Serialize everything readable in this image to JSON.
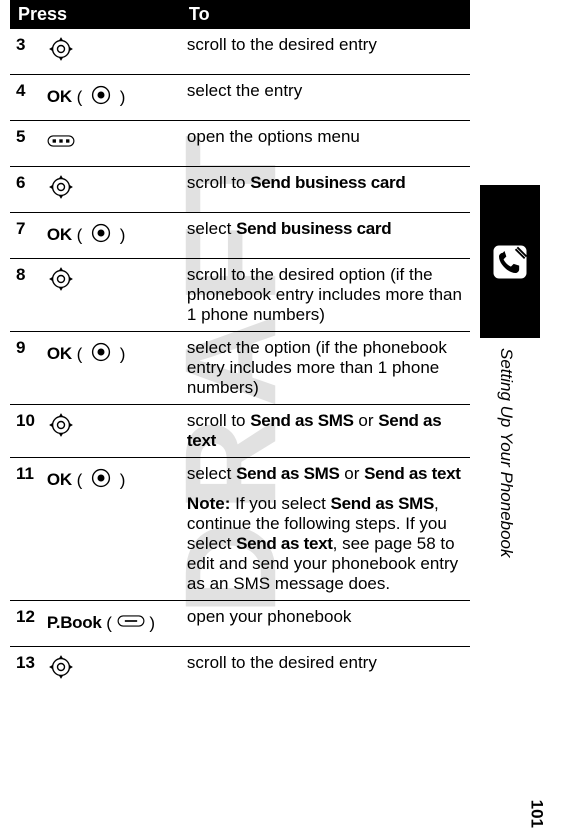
{
  "watermark": "DRAFT",
  "header": {
    "col_press": "Press",
    "col_to": "To"
  },
  "rows": [
    {
      "num": "3",
      "press_label": "",
      "press_icon": "nav",
      "to": "scroll to the desired entry"
    },
    {
      "num": "4",
      "press_label": "OK",
      "press_icon": "select",
      "to": "select the entry"
    },
    {
      "num": "5",
      "press_label": "",
      "press_icon": "menu",
      "to": "open the options menu"
    },
    {
      "num": "6",
      "press_label": "",
      "press_icon": "nav",
      "to_prefix": "scroll to ",
      "to_bold": "Send business card"
    },
    {
      "num": "7",
      "press_label": "OK",
      "press_icon": "select",
      "to_prefix": "select ",
      "to_bold": "Send business card"
    },
    {
      "num": "8",
      "press_label": "",
      "press_icon": "nav",
      "to": "scroll to the desired option (if the phonebook entry includes more than 1 phone numbers)"
    },
    {
      "num": "9",
      "press_label": "OK",
      "press_icon": "select",
      "to": "select the option (if the phonebook entry includes more than 1 phone numbers)"
    },
    {
      "num": "10",
      "press_label": "",
      "press_icon": "nav",
      "to_prefix": "scroll to ",
      "to_bold": "Send as SMS",
      "to_mid": " or ",
      "to_bold2": "Send as text"
    },
    {
      "num": "11",
      "press_label": "OK",
      "press_icon": "select",
      "to_prefix": "select ",
      "to_bold": "Send as SMS",
      "to_mid": " or ",
      "to_bold2": "Send as text",
      "note_label": "Note:",
      "note_prefix": " If you select ",
      "note_bold": "Send as SMS",
      "note_mid": ", continue the following steps. If you select ",
      "note_bold2": "Send as text",
      "note_suffix": ", see page 58 to edit and send your phonebook entry as an SMS message does."
    },
    {
      "num": "12",
      "press_label": "P.Book",
      "press_icon": "soft",
      "to": "open your phonebook"
    },
    {
      "num": "13",
      "press_label": "",
      "press_icon": "nav",
      "to": "scroll to the desired entry"
    }
  ],
  "sidebar": {
    "section_title": "Setting Up Your Phonebook"
  },
  "page_number": "101"
}
